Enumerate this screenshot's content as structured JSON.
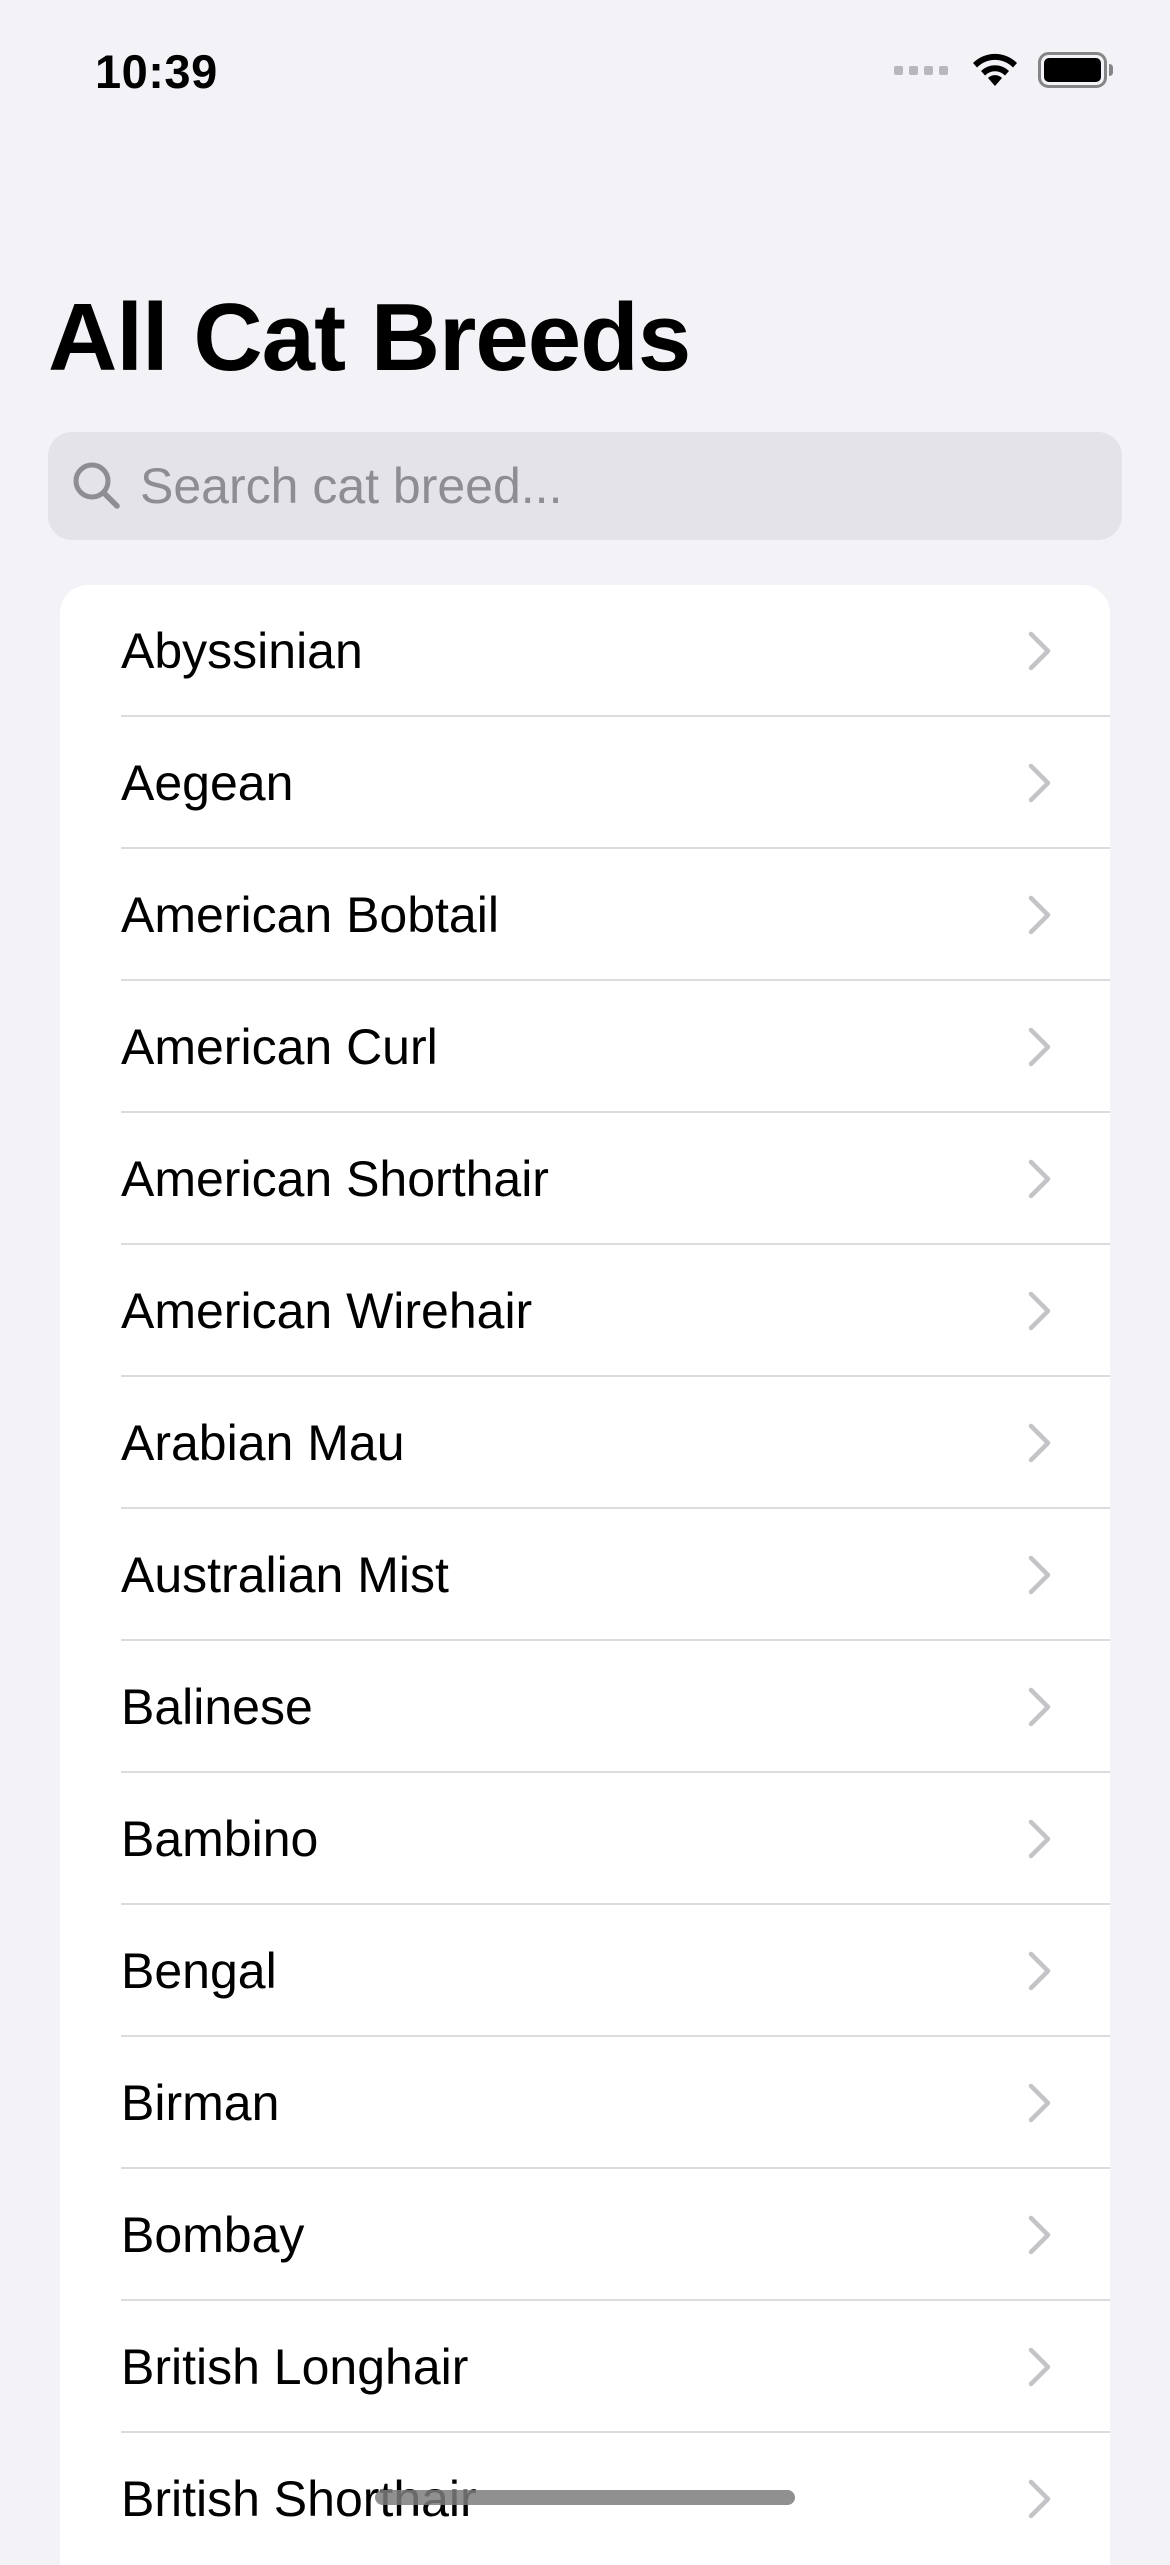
{
  "status_bar": {
    "time": "10:39",
    "icons": [
      "cellular-signal-icon",
      "wifi-icon",
      "battery-icon"
    ]
  },
  "page": {
    "title": "All Cat Breeds"
  },
  "search": {
    "placeholder": "Search cat breed...",
    "value": "",
    "icon": "search-icon"
  },
  "breeds": [
    {
      "name": "Abyssinian"
    },
    {
      "name": "Aegean"
    },
    {
      "name": "American Bobtail"
    },
    {
      "name": "American Curl"
    },
    {
      "name": "American Shorthair"
    },
    {
      "name": "American Wirehair"
    },
    {
      "name": "Arabian Mau"
    },
    {
      "name": "Australian Mist"
    },
    {
      "name": "Balinese"
    },
    {
      "name": "Bambino"
    },
    {
      "name": "Bengal"
    },
    {
      "name": "Birman"
    },
    {
      "name": "Bombay"
    },
    {
      "name": "British Longhair"
    },
    {
      "name": "British Shorthair"
    }
  ],
  "colors": {
    "background": "#f2f2f7",
    "list_background": "#ffffff",
    "search_background": "#e3e3e8",
    "placeholder": "#8d8d93",
    "chevron": "#c4c4c8",
    "separator": "#dcdce0"
  }
}
